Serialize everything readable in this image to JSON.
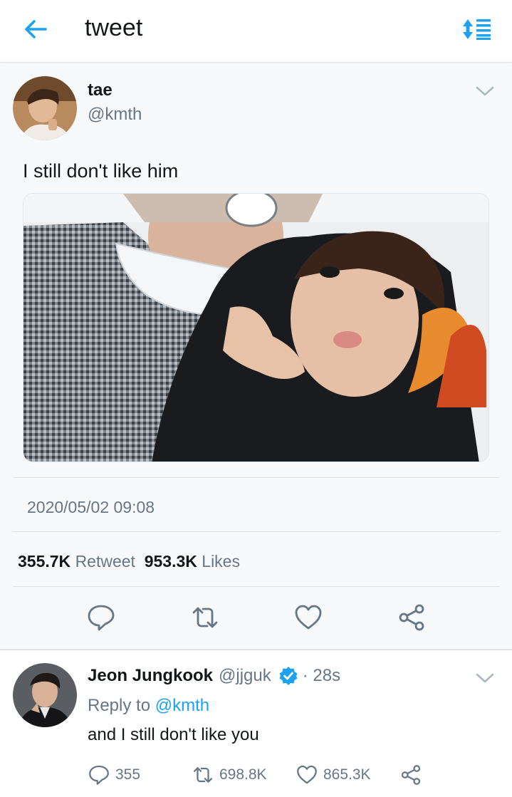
{
  "header": {
    "title": "tweet"
  },
  "tweet": {
    "display_name": "tae",
    "handle": "@kmth",
    "text": "I still don't like him",
    "timestamp": "2020/05/02 09:08",
    "retweet_count": "355.7K",
    "retweet_label": "Retweet",
    "like_count": "953.3K",
    "like_label": "Likes"
  },
  "reply": {
    "display_name": "Jeon Jungkook",
    "handle": "@jjguk",
    "time": "· 28s",
    "reply_to_label": "Reply to",
    "reply_to_handle": "@kmth",
    "text": "and I still don't like you",
    "replies": "355",
    "retweets": "698.8K",
    "likes": "865.3K"
  },
  "icons": {
    "back": "arrow-left-icon",
    "sort": "sort-list-icon",
    "caret": "chevron-down-icon",
    "reply": "speech-bubble-icon",
    "retweet": "retweet-icon",
    "like": "heart-icon",
    "share": "share-icon",
    "verified": "verified-badge-icon"
  },
  "colors": {
    "accent": "#1da1f2",
    "muted": "#657786",
    "text": "#14171a"
  }
}
